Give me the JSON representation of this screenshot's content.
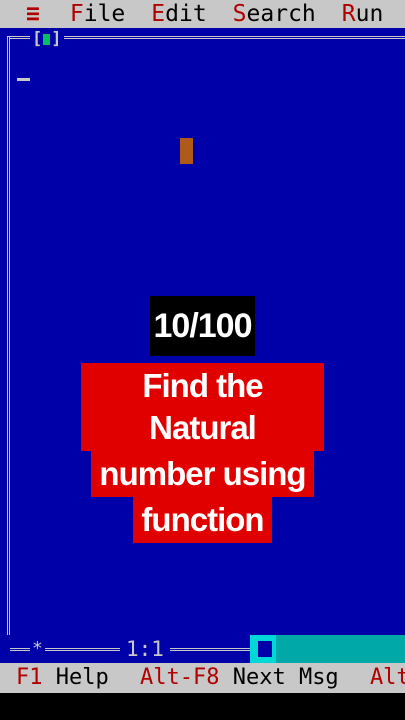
{
  "menu": {
    "system_icon": "≡",
    "items": [
      {
        "hotkey": "F",
        "rest": "ile"
      },
      {
        "hotkey": "E",
        "rest": "dit"
      },
      {
        "hotkey": "S",
        "rest": "earch"
      },
      {
        "hotkey": "R",
        "rest": "un"
      }
    ]
  },
  "window": {
    "close_box_left": "[",
    "close_box_right": "]"
  },
  "overlay": {
    "counter": "10/100",
    "title_lines": [
      "Find the Natural",
      "number using",
      "function"
    ]
  },
  "status": {
    "star": "*",
    "cursor_pos": "1:1"
  },
  "function_keys": [
    {
      "key": "F1",
      "label": "Help"
    },
    {
      "key": "Alt-F8",
      "label": "Next Msg"
    },
    {
      "key": "Alt",
      "label": ""
    }
  ],
  "colors": {
    "editor_bg": "#0000a8",
    "menu_bg": "#c8c8c8",
    "hotkey": "#b00000",
    "overlay_red": "#e00000"
  }
}
